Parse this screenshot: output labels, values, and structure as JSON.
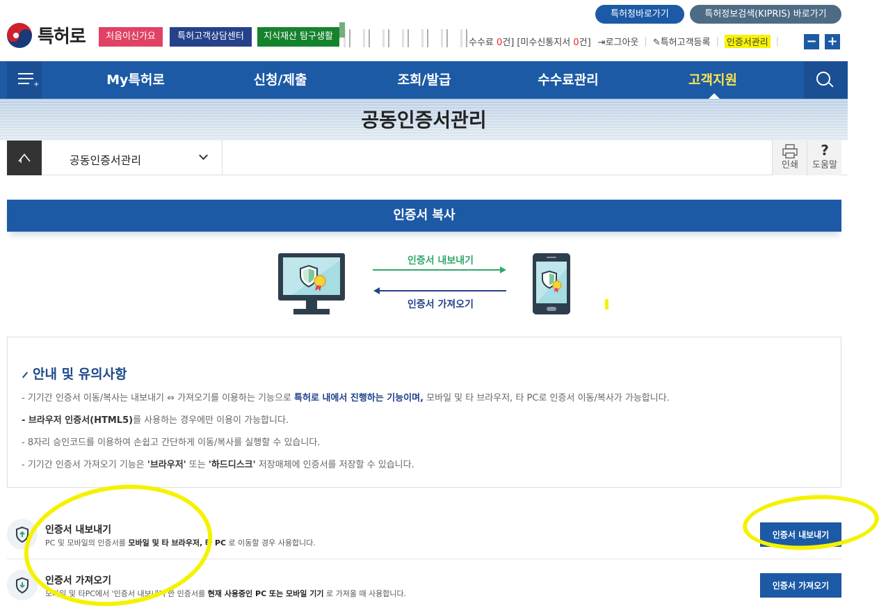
{
  "header": {
    "logo_text": "특허로",
    "pill_kipo": "특허청바로가기",
    "pill_kipris": "특허정보검색(KIPRIS) 바로가기",
    "quick": [
      "처음이신가요",
      "특허고객상담센터",
      "지식재산 탐구생활"
    ],
    "util": {
      "fee_prefix": "수수료",
      "fee_count": "0",
      "fee_suffix": "건]",
      "unread_prefix": "[미수신통지서",
      "unread_count": "0",
      "unread_suffix": "건]",
      "logout": "로그아웃",
      "register": "특허고객등록",
      "cert_manage": "인증서관리"
    },
    "zoom_out": "−",
    "zoom_in": "+"
  },
  "nav": {
    "items": [
      "My특허로",
      "신청/제출",
      "조회/발급",
      "수수료관리",
      "고객지원"
    ],
    "active_index": 4
  },
  "page_title": "공동인증서관리",
  "breadcrumb": {
    "current": "공동인증서관리",
    "print": "인쇄",
    "help_symbol": "?",
    "help": "도움말"
  },
  "section_title": "인증서 복사",
  "illustration": {
    "export_label": "인증서 내보내기",
    "import_label": "인증서 가져오기"
  },
  "notice": {
    "title": "안내 및 유의사항",
    "line1_a": "- 기기간 인증서 이동/복사는 내보내기 ⇔ 가져오기를 이용하는 기능으로 ",
    "line1_b": "특허로 내에서 진행하는 기능이며,",
    "line1_c": " 모바일 및 타 브라우저, 타 PC로 인증서 이동/복사가 가능합니다.",
    "line2_a": "- 브라우저 인증서(HTML5)",
    "line2_b": "를 사용하는 경우에만 이용이 가능합니다.",
    "line3": "- 8자리 승인코드를 이용하여 손쉽고 간단하게 이동/복사를 실행할 수 있습니다.",
    "line4_a": "- 기기간 인증서 가져오기 기능은 ",
    "line4_b": "'브라우저'",
    "line4_c": " 또는 ",
    "line4_d": "'하드디스크'",
    "line4_e": " 저장매체에 인증서를 저장할 수 있습니다."
  },
  "actions": {
    "export": {
      "title": "인증서 내보내기",
      "desc_a": "PC 및 모바일의 인증서를 ",
      "desc_b": "모바일 및 타 브라우저, 타 PC",
      "desc_c": " 로 이동할 경우 사용합니다.",
      "button": "인증서 내보내기"
    },
    "import": {
      "title": "인증서 가져오기",
      "desc_a": "모바일 및 타PC에서 '인증서 내보내기'한 인증서를 ",
      "desc_b": "현재 사용중인 PC 또는 모바일 기기",
      "desc_c": " 로 가져올 때 사용합니다.",
      "button": "인증서 가져오기"
    }
  },
  "colors": {
    "primary": "#1c5aa6",
    "active_nav": "#ffe44d",
    "highlight": "#f5f200",
    "export_arrow": "#2fa86a",
    "import_arrow": "#25418a"
  }
}
